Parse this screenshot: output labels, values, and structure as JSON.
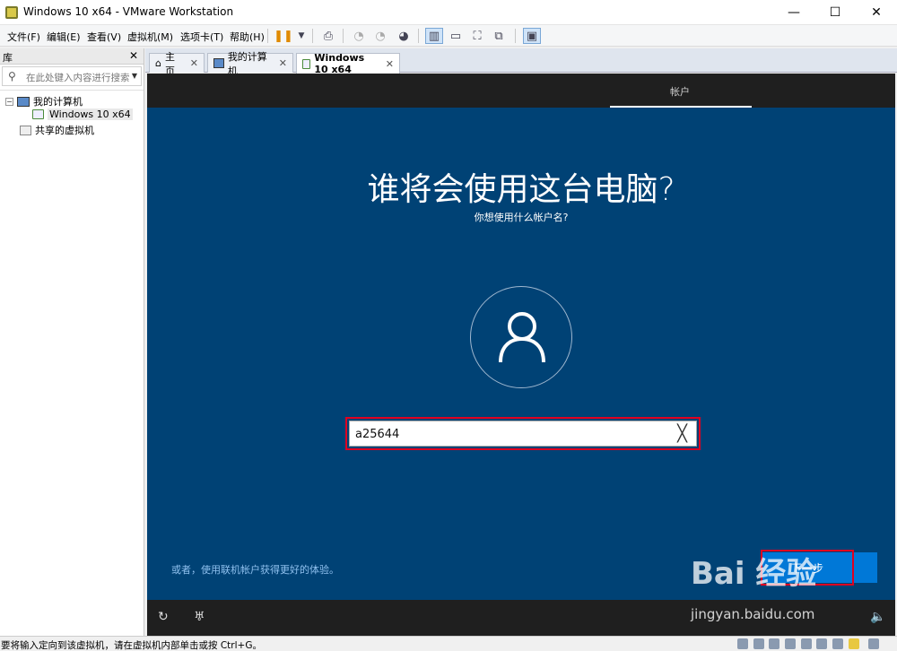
{
  "window": {
    "title": "Windows 10 x64 - VMware Workstation",
    "minimize": "—",
    "maximize": "☐",
    "close": "✕"
  },
  "menu": [
    "文件(F)",
    "编辑(E)",
    "查看(V)",
    "虚拟机(M)",
    "选项卡(T)",
    "帮助(H)"
  ],
  "library": {
    "title": "库",
    "close": "✕",
    "search_placeholder": "在此处键入内容进行搜索",
    "tree": {
      "my_computer": "我的计算机",
      "vm": "Windows 10 x64",
      "shared": "共享的虚拟机"
    }
  },
  "tabs": [
    {
      "label": "主页",
      "close": "✕"
    },
    {
      "label": "我的计算机",
      "close": "✕"
    },
    {
      "label": "Windows 10 x64",
      "close": "✕"
    }
  ],
  "guest": {
    "top_tab": "帐户",
    "title": "谁将会使用这台电脑?",
    "subtitle": "你想使用什么帐户名?",
    "username_value": "a25644",
    "clear": "╳",
    "online_link": "或者，使用联机帐户获得更好的体验。",
    "next_button": "下一步"
  },
  "watermark": {
    "brand": "Bai 经验",
    "url": "jingyan.baidu.com"
  },
  "statusbar": {
    "message": "要将输入定向到该虚拟机，请在虚拟机内部单击或按 Ctrl+G。"
  }
}
